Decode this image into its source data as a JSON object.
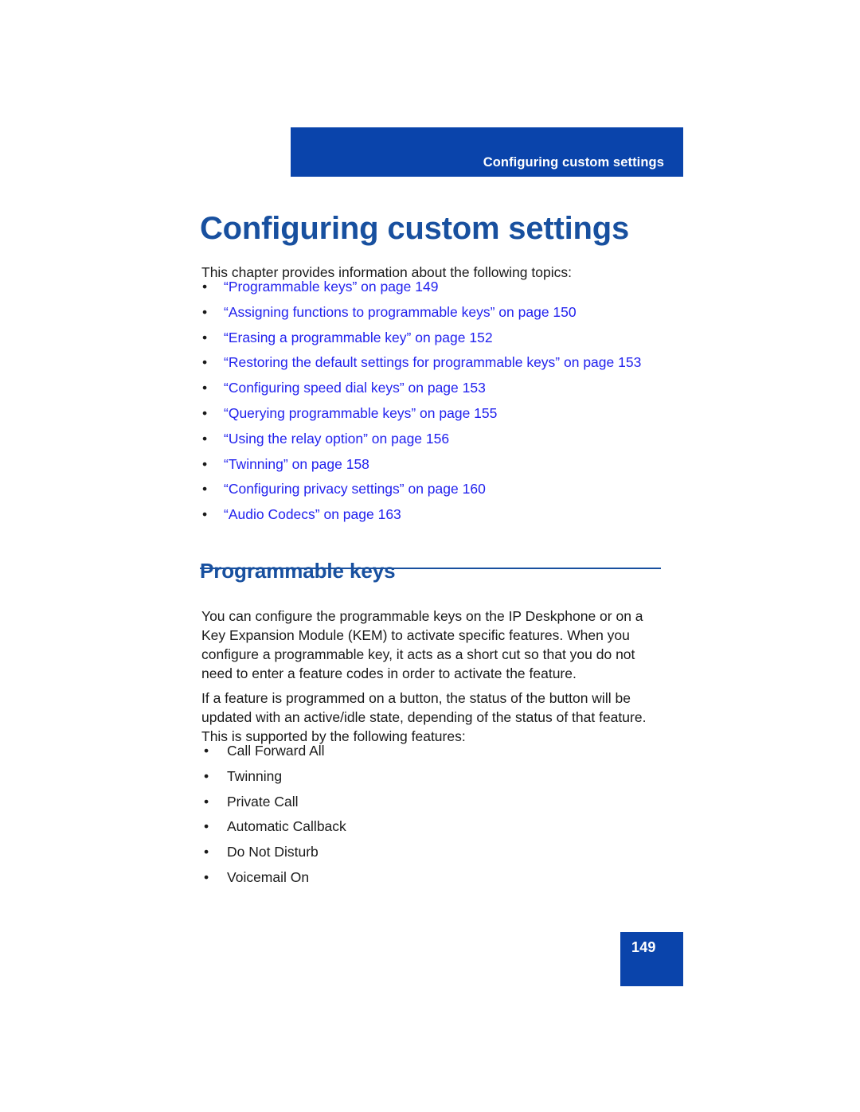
{
  "document": {
    "running_header": "Configuring custom settings",
    "chapter_title": "Configuring custom settings",
    "intro": "This chapter provides information about the following topics:",
    "toc": {
      "bullet_glyph": "•",
      "items": [
        {
          "label": "“Programmable keys” on page 149"
        },
        {
          "label": " “Assigning functions to programmable keys” on page 150"
        },
        {
          "label": "“Erasing a programmable key” on page 152"
        },
        {
          "label": "“Restoring the default settings for programmable keys” on page 153"
        },
        {
          "label": "“Configuring speed dial keys” on page 153"
        },
        {
          "label": "“Querying programmable keys” on page 155"
        },
        {
          "label": "“Using the relay option” on page 156"
        },
        {
          "label": "“Twinning” on page 158"
        },
        {
          "label": "“Configuring privacy settings” on page 160"
        },
        {
          "label": "“Audio Codecs” on page 163"
        }
      ]
    },
    "section": {
      "heading": "Programmable keys",
      "paragraph_1": "You can configure the programmable keys on the IP Deskphone or on a Key Expansion Module (KEM) to activate specific features. When you configure a programmable key, it acts as a short cut so that you do not need to enter a feature codes in order to activate the feature.",
      "paragraph_2": "If a feature is programmed on a button, the status of the button will be updated with an active/idle state, depending of the status of that feature. This is supported by the following features:"
    },
    "features": {
      "bullet_glyph": "•",
      "items": [
        {
          "label": "Call Forward All"
        },
        {
          "label": "Twinning"
        },
        {
          "label": "Private Call"
        },
        {
          "label": "Automatic Callback"
        },
        {
          "label": "Do Not Disturb"
        },
        {
          "label": "Voicemail On"
        }
      ]
    },
    "page_number": "149",
    "colors": {
      "banner_blue": "#0a44ab",
      "heading_blue": "#18509f",
      "link_blue": "#2222ee",
      "body_text": "#1a1a1a",
      "page_background": "#ffffff"
    }
  }
}
